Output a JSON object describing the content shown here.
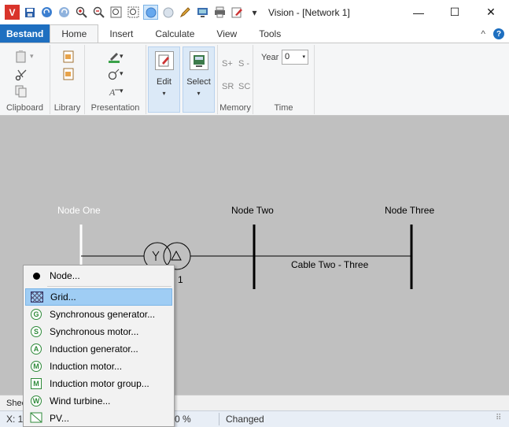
{
  "window": {
    "title": "Vision - [Network 1]",
    "qa_icons": [
      "app-icon",
      "save-icon",
      "undo-icon",
      "redo-icon",
      "zoom-in-icon",
      "zoom-out-icon",
      "zoom-fit-icon",
      "zoom-window-icon",
      "circle-select-icon",
      "circle-icon",
      "pencil-icon",
      "monitor-icon",
      "printer-icon",
      "edit-note-icon",
      "dropdown-icon"
    ],
    "minimize": "—",
    "maximize": "☐",
    "close": "✕"
  },
  "ribbon": {
    "tabs": [
      "Bestand",
      "Home",
      "Insert",
      "Calculate",
      "View",
      "Tools"
    ],
    "active_tab": "Home",
    "collapse": "^",
    "help": "?",
    "groups": {
      "clipboard": "Clipboard",
      "library": "Library",
      "presentation": "Presentation",
      "memory": "Memory",
      "time": "Time"
    },
    "edit_label": "Edit",
    "select_label": "Select",
    "dropdown_caret": "▾",
    "memory": {
      "s_plus": "S+",
      "s_minus": "S -",
      "sr": "SR",
      "sc": "SC"
    },
    "year_label": "Year",
    "year_value": "0"
  },
  "canvas": {
    "node_one": "Node One",
    "node_two": "Node Two",
    "node_three": "Node Three",
    "cable_label": "Cable Two - Three",
    "transformer_index": "1"
  },
  "context_menu": {
    "items": [
      {
        "label": "Node...",
        "icon": "node-dot-icon"
      },
      {
        "label": "Grid...",
        "icon": "grid-icon",
        "highlighted": true
      },
      {
        "label": "Synchronous generator...",
        "icon": "G"
      },
      {
        "label": "Synchronous motor...",
        "icon": "S"
      },
      {
        "label": "Induction generator...",
        "icon": "A"
      },
      {
        "label": "Induction motor...",
        "icon": "M"
      },
      {
        "label": "Induction motor group...",
        "icon": "M"
      },
      {
        "label": "Wind turbine...",
        "icon": "W"
      },
      {
        "label": "PV...",
        "icon": "pv-icon"
      }
    ]
  },
  "sheet": {
    "label": "Shee"
  },
  "status": {
    "coords": "X: 1",
    "zoom": "0 %",
    "state": "Changed",
    "grip": "⠿"
  }
}
